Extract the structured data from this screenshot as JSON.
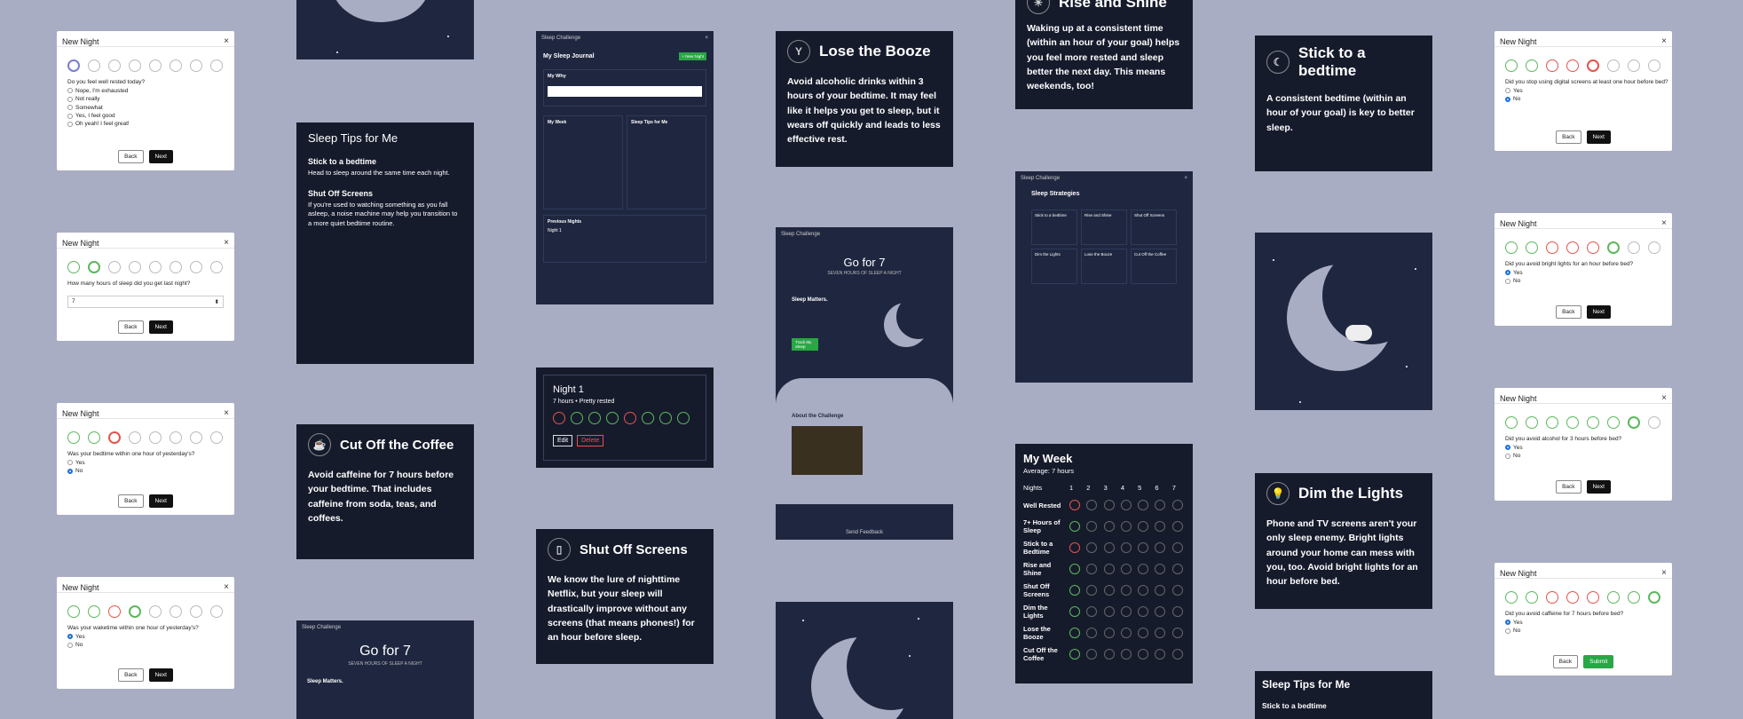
{
  "modals": {
    "title": "New Night",
    "close": "×",
    "back": "Back",
    "next": "Next",
    "submit": "Submit",
    "q_rested": "Do you feel well rested today?",
    "rested_options": [
      "Nope, I'm exhausted",
      "Not really",
      "Somewhat",
      "Yes, I feel good",
      "Oh yeah! I feel great!"
    ],
    "q_hours": "How many hours of sleep did you get last night?",
    "hours_value": "7",
    "q_bedtime": "Was your bedtime within one hour of yesterday's?",
    "q_waketime": "Was your waketime within one hour of yesterday's?",
    "q_screens": "Did you stop using digital screens at least one hour before bed?",
    "q_lights": "Did you avoid bright lights for an hour before bed?",
    "q_alcohol": "Did you avoid alcohol for 3 hours before bed?",
    "q_caffeine": "Did you avoid caffeine for 7 hours before bed?",
    "yes": "Yes",
    "no": "No"
  },
  "tips_panel": {
    "title": "Sleep Tips for Me",
    "tip1_title": "Stick to a bedtime",
    "tip1_text": "Head to sleep around the same time each night.",
    "tip2_title": "Shut Off Screens",
    "tip2_text": "If you're used to watching something as you fall asleep, a noise machine may help you transition to a more quiet bedtime routine."
  },
  "cards": {
    "coffee_title": "Cut Off the Coffee",
    "coffee_text": "Avoid caffeine for 7 hours before your bedtime. That includes caffeine from soda, teas, and coffees.",
    "booze_title": "Lose the Booze",
    "booze_text": "Avoid alcoholic drinks within 3 hours of your bedtime. It may feel like it helps you get to sleep, but it wears off quickly and leads to less effective rest.",
    "rise_title": "Rise and Shine",
    "rise_text": "Waking up at a consistent time (within an hour of your goal) helps you feel more rested and sleep better the next day. This means weekends, too!",
    "bedtime_title": "Stick to a bedtime",
    "bedtime_text": "A consistent bedtime (within an hour of your goal) is key to better sleep.",
    "screens_title": "Shut Off Screens",
    "screens_text": "We know the lure of nighttime Netflix, but your sleep will drastically improve without any screens (that means phones!) for an hour before sleep.",
    "lights_title": "Dim the Lights",
    "lights_text": "Phone and TV screens aren't your only sleep enemy. Bright lights around your home can mess with you, too. Avoid bright lights for an hour before bed."
  },
  "night_card": {
    "title": "Night 1",
    "subtitle": "7 hours • Pretty rested",
    "edit": "Edit",
    "delete": "Delete"
  },
  "week": {
    "title": "My Week",
    "average": "Average: 7 hours",
    "nights_label": "Nights",
    "days": [
      "1",
      "2",
      "3",
      "4",
      "5",
      "6",
      "7"
    ],
    "rows": [
      "Well Rested",
      "7+ Hours of Sleep",
      "Stick to a Bedtime",
      "Rise and Shine",
      "Shut Off Screens",
      "Dim the Lights",
      "Lose the Booze",
      "Cut Off the Coffee"
    ]
  },
  "landing": {
    "brand": "Sleep Challenge",
    "hero": "Go for 7",
    "hero_sub": "SEVEN HOURS OF SLEEP A NIGHT",
    "matters": "Sleep Matters.",
    "cta": "Track My Sleep",
    "about": "About the Challenge",
    "feedback": "Send Feedback"
  },
  "journal": {
    "title": "My Sleep Journal",
    "new_night": "+ New Night",
    "my_why": "My Why",
    "my_week": "My Week",
    "tips": "Sleep Tips for Me",
    "previous": "Previous Nights",
    "night1": "Night 1"
  },
  "strategies": {
    "title": "Sleep Strategies",
    "items": [
      "Stick to a bedtime",
      "Rise and Shine",
      "Shut Off Screens",
      "Dim the Lights",
      "Lose the Booze",
      "Cut Off the Coffee"
    ]
  },
  "bottom_tips": {
    "title": "Sleep Tips for Me",
    "tip1": "Stick to a bedtime"
  }
}
